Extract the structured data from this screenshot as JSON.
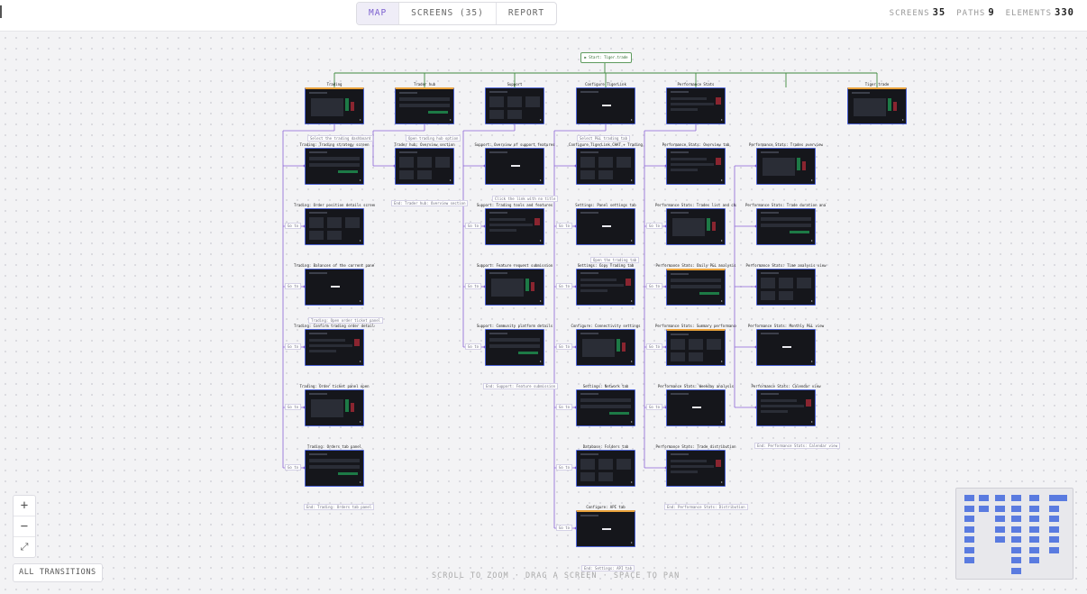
{
  "header": {
    "tabs": [
      {
        "label": "MAP",
        "active": true
      },
      {
        "label": "SCREENS (35)",
        "active": false
      },
      {
        "label": "REPORT",
        "active": false
      }
    ],
    "stats": [
      {
        "label": "SCREENS",
        "value": "35"
      },
      {
        "label": "PATHS",
        "value": "9"
      },
      {
        "label": "ELEMENTS",
        "value": "330"
      }
    ]
  },
  "start_node": {
    "label": "▶ Start: Tiger.trade"
  },
  "columns": [
    {
      "title": "Trading",
      "screens": [
        "Trading: Trading strategy screen",
        "Trading: Order position details screen",
        "Trading: Balances of the current panel",
        "Trading: Confirm trading order details",
        "Trading: Order ticket panel open",
        "Trading: Orders tab panel"
      ]
    },
    {
      "title": "Trader hub",
      "screens": [
        "Trader hub: Overview section"
      ]
    },
    {
      "title": "Support",
      "screens": [
        "Support: Overview of support features",
        "Support: Trading tools and features",
        "Support: Feature request submission",
        "Support: Community platform details"
      ]
    },
    {
      "title": "Configure TigerLink",
      "screens": [
        "Configure TigerLink CHAT + Trading",
        "Settings: Panel settings tab",
        "Settings: Copy Trading tab",
        "Configure: Connectivity settings",
        "Settings: Network tab",
        "Database: Folders tab",
        "Configure: API tab"
      ]
    },
    {
      "title": "Performance Stats",
      "screens": [
        "Performance Stats: Overview tab",
        "Performance Stats: Trades list and chart",
        "Performance Stats: Daily P&L analysis",
        "Performance Stats: Summary performance",
        "Performance Stats: Weekday analysis",
        "Performance Stats: Trade distribution"
      ]
    },
    {
      "title": "",
      "screens": [
        "Performance Stats: Trades overview",
        "Performance Stats: Trade duration analysis",
        "Performance Stats: Time analysis view",
        "Performance Stats: Monthly P&L view",
        "Performance Stats: Calendar view"
      ]
    },
    {
      "title": "Tiger.trade",
      "screens": []
    }
  ],
  "edge_labels": [
    "Select the trading dashboard",
    "Open trading hub option",
    "Click the link with no title",
    "Select P&L trading tab",
    "Open the trading tab",
    "Open the trading tab",
    "Open settings tab",
    "Trading: Open order ticket panel",
    "Trader hub: Overview section",
    "Click confirm details",
    "End: Trader hub: Overview section",
    "End: Support: Feature submission",
    "End: Trading: Orders tab panel",
    "End: Settings: API tab",
    "End: Performance Stats: Distribution",
    "End: Performance Stats: Calendar view",
    "Go to",
    "Go to",
    "Go to",
    "Go to",
    "Go to",
    "Go to",
    "Go to",
    "Go to",
    "Go to",
    "Go to",
    "Go to",
    "Go to",
    "Go to",
    "Go to",
    "Go to",
    "Go to",
    "Go to",
    "Go to"
  ],
  "controls": {
    "zoom_in": "+",
    "zoom_out": "−",
    "fit": "⤢",
    "all_transitions": "ALL TRANSITIONS",
    "hint": "SCROLL TO ZOOM · DRAG A SCREEN · SPACE TO PAN"
  },
  "colors": {
    "accent": "#7b5fcf",
    "node_border": "#4d63d6",
    "start_border": "#5e9b5e",
    "trunk_line": "#3f8a3f",
    "edge_line": "#8a62d6",
    "highlight": "#e9a23b"
  }
}
